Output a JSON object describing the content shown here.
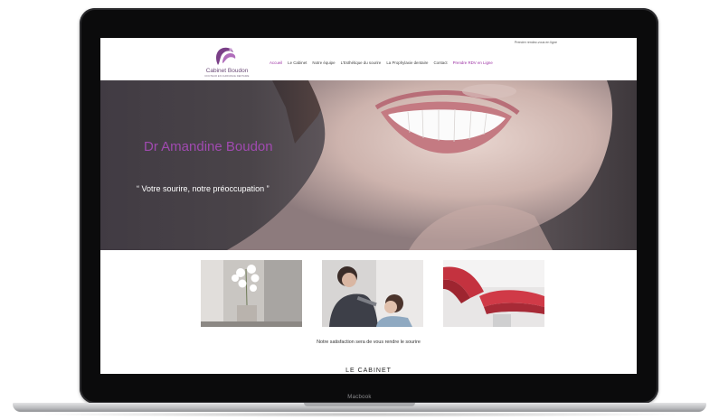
{
  "device": {
    "label": "Macbook"
  },
  "header": {
    "top_link": "Prendre rendez-vous en ligne",
    "logo": {
      "name": "Cabinet Boudon",
      "tagline": "DOCTEUR EN CHIRURGIE DENTAIRE"
    },
    "nav": [
      {
        "label": "Accueil",
        "active": true
      },
      {
        "label": "Le Cabinet"
      },
      {
        "label": "Notre équipe"
      },
      {
        "label": "L'Esthétique du sourire"
      },
      {
        "label": "La Prophylaxie dentaire"
      },
      {
        "label": "Contact"
      },
      {
        "label": "Prendre RDV en Ligne"
      }
    ]
  },
  "hero": {
    "title": "Dr Amandine Boudon",
    "quote": "“ Votre sourire, notre préoccupation ”"
  },
  "gallery": {
    "caption": "Notre satisfaction sera de vous rendre le sourire"
  },
  "section": {
    "title": "LE CABINET"
  },
  "colors": {
    "accent": "#9b2fa3",
    "hero_title": "#a04ab0",
    "bezel": "#0b0b0c"
  }
}
